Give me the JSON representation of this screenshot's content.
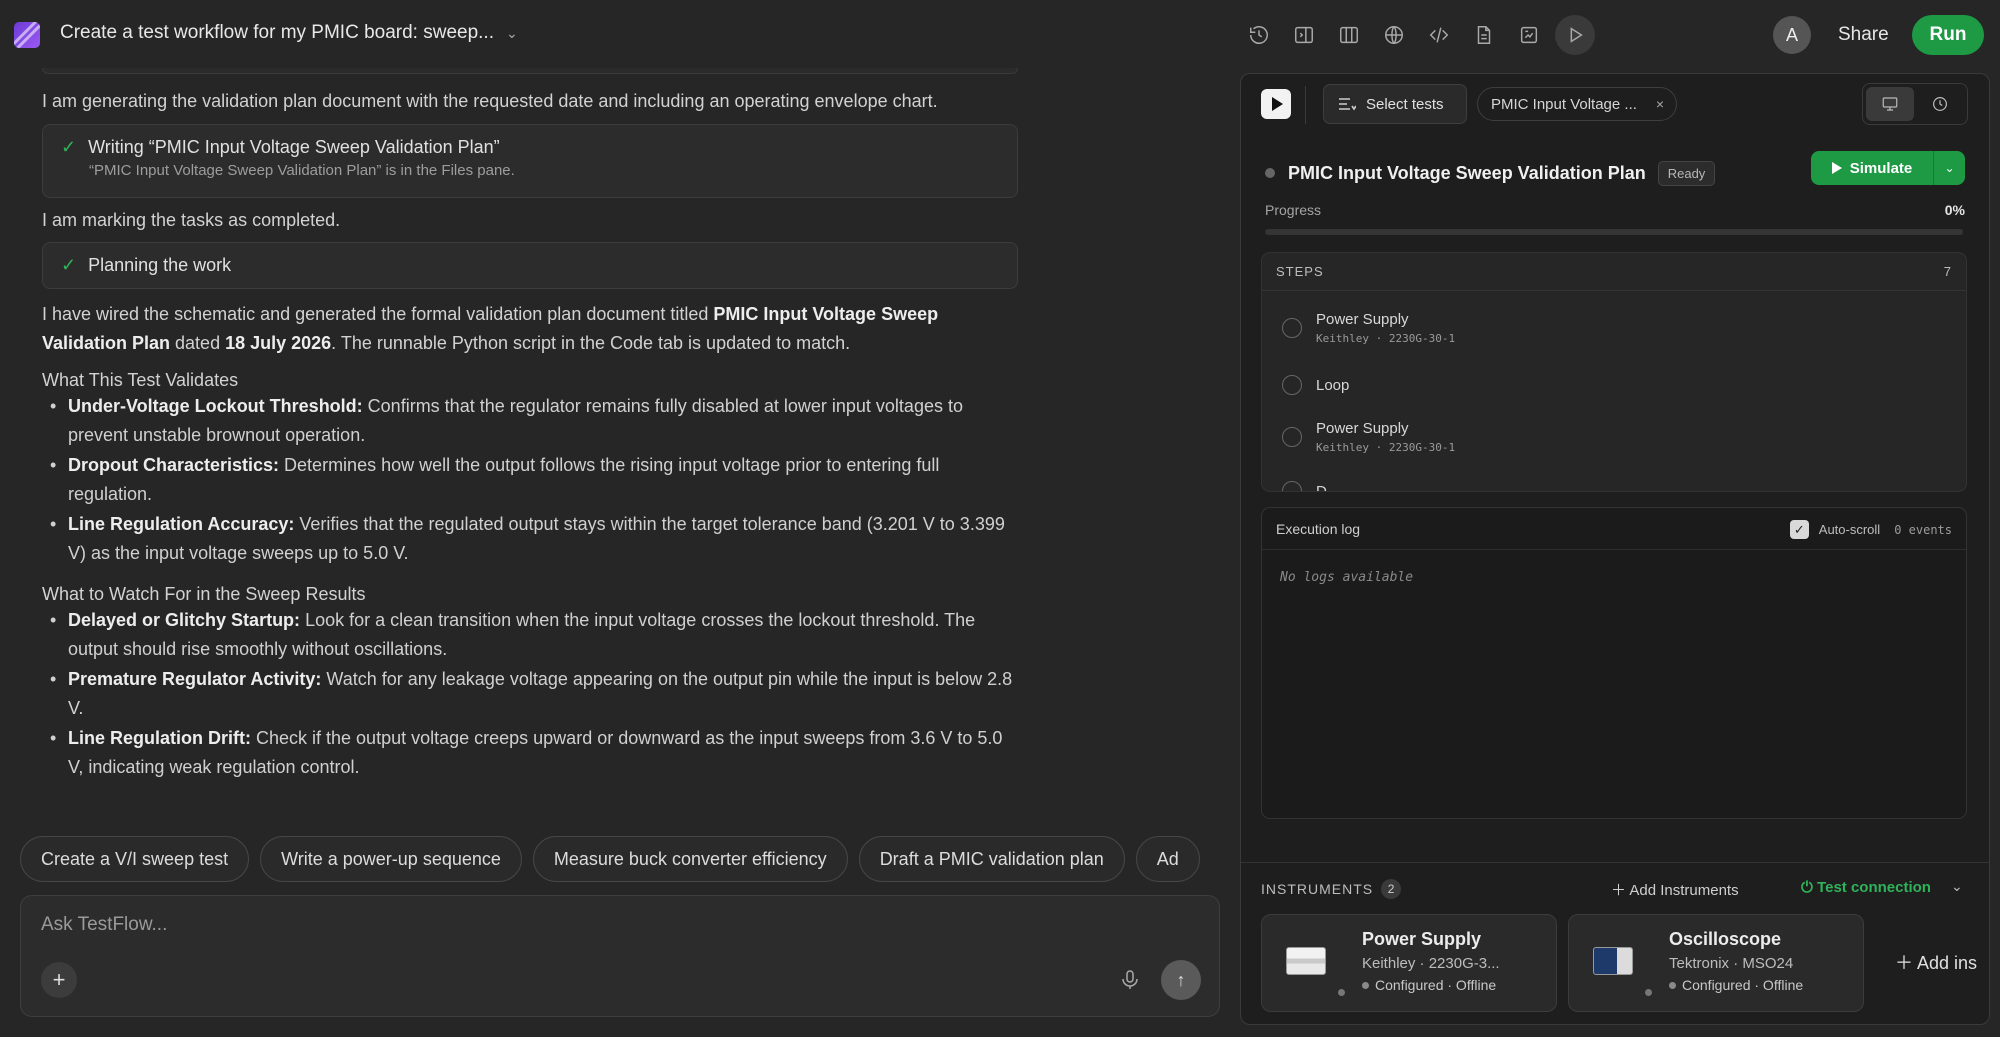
{
  "header": {
    "title": "Create a test workflow for my PMIC board: sweep...",
    "avatar_initial": "A",
    "share_label": "Share",
    "run_label": "Run",
    "icons": [
      "history-icon",
      "panel-right-icon",
      "columns-icon",
      "globe-icon",
      "code-icon",
      "document-icon",
      "report-icon",
      "play-icon"
    ]
  },
  "chat": {
    "p1": "I am generating the validation plan document with the requested date and including an operating envelope chart.",
    "task1_title": "Writing “PMIC Input Voltage Sweep Validation Plan”",
    "task1_sub": "“PMIC Input Voltage Sweep Validation Plan” is in the Files pane.",
    "p2": "I am marking the tasks as completed.",
    "task2_title": "Planning the work",
    "p3_a": "I have wired the schematic and generated the formal validation plan document titled ",
    "p3_b": "PMIC Input Voltage Sweep Validation Plan",
    "p3_c": " dated ",
    "p3_d": "18 July 2026",
    "p3_e": ". The runnable Python script in the Code tab is updated to match.",
    "h1": "What This Test Validates",
    "list1": [
      {
        "bold": "Under-Voltage Lockout Threshold:",
        "text": " Confirms that the regulator remains fully disabled at lower input voltages to prevent unstable brownout operation."
      },
      {
        "bold": "Dropout Characteristics:",
        "text": " Determines how well the output follows the rising input voltage prior to entering full regulation."
      },
      {
        "bold": "Line Regulation Accuracy:",
        "text": " Verifies that the regulated output stays within the target tolerance band (3.201 V to 3.399 V) as the input voltage sweeps up to 5.0 V."
      }
    ],
    "h2": "What to Watch For in the Sweep Results",
    "list2": [
      {
        "bold": "Delayed or Glitchy Startup:",
        "text": " Look for a clean transition when the input voltage crosses the lockout threshold. The output should rise smoothly without oscillations."
      },
      {
        "bold": "Premature Regulator Activity:",
        "text": " Watch for any leakage voltage appearing on the output pin while the input is below 2.8 V."
      },
      {
        "bold": "Line Regulation Drift:",
        "text": " Check if the output voltage creeps upward or downward as the input sweeps from 3.6 V to 5.0 V, indicating weak regulation control."
      }
    ]
  },
  "suggestions": [
    "Create a V/I sweep test",
    "Write a power-up sequence",
    "Measure buck converter efficiency",
    "Draft a PMIC validation plan",
    "Ad"
  ],
  "composer": {
    "placeholder": "Ask TestFlow...",
    "add_label": "+",
    "send_label": "↑"
  },
  "panel": {
    "select_tests_label": "Select tests",
    "chip_label": "PMIC Input Voltage ...",
    "chip_close": "×",
    "plan_title": "PMIC Input Voltage Sweep Validation Plan",
    "status": "Ready",
    "simulate_label": "Simulate",
    "progress_label": "Progress",
    "progress_value": "0%",
    "progress_fraction": 0,
    "steps_label": "STEPS",
    "steps_count": "7",
    "steps": [
      {
        "name": "Power Supply",
        "sub": "Keithley · 2230G-30-1"
      },
      {
        "name": "Loop",
        "sub": ""
      },
      {
        "name": "Power Supply",
        "sub": "Keithley · 2230G-30-1"
      },
      {
        "name": "D...",
        "sub": ""
      }
    ],
    "log_label": "Execution log",
    "autoscroll_label": "Auto-scroll",
    "events_label": "0 events",
    "empty_log": "No logs available",
    "instruments_label": "INSTRUMENTS",
    "instruments_count": "2",
    "add_instruments_label": "Add Instruments",
    "test_connection_label": "Test connection",
    "instruments": [
      {
        "name": "Power Supply",
        "sub": "Keithley · 2230G-3...",
        "status": "Configured · Offline"
      },
      {
        "name": "Oscilloscope",
        "sub": "Tektronix · MSO24",
        "status": "Configured · Offline"
      }
    ],
    "add_ins_partial": "Add ins"
  },
  "colors": {
    "accent_green": "#1e9a45",
    "background": "#262626",
    "panel": "#1e1e1e"
  }
}
